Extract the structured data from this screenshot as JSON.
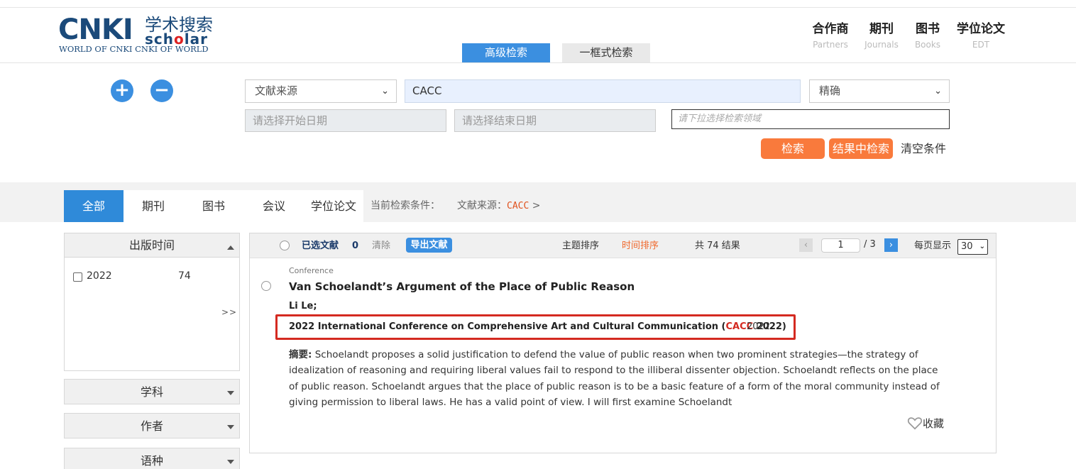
{
  "header": {
    "logo": {
      "main": "CNKI",
      "cn": "学术搜索",
      "scholar": "scholar",
      "slogan": "WORLD OF CNKI CNKI OF WORLD"
    },
    "nav": [
      {
        "zh": "合作商",
        "en": "Partners"
      },
      {
        "zh": "期刊",
        "en": "Journals"
      },
      {
        "zh": "图书",
        "en": "Books"
      },
      {
        "zh": "学位论文",
        "en": "EDT"
      }
    ],
    "search_tabs": {
      "advanced": "高级检索",
      "one_box": "一框式检索"
    }
  },
  "search_form": {
    "add_symbol": "+",
    "remove_symbol": "−",
    "field_select": "文献来源",
    "query_value": "CACC",
    "match_select": "精确",
    "start_date_placeholder": "请选择开始日期",
    "end_date_placeholder": "请选择结束日期",
    "domain_placeholder": "请下拉选择检索领域",
    "search_button": "检索",
    "search_within_button": "结果中检索",
    "clear_label": "清空条件"
  },
  "category_tabs": [
    "全部",
    "期刊",
    "图书",
    "会议",
    "学位论文"
  ],
  "current_condition": {
    "label": "当前检索条件：",
    "field": "文献来源：",
    "value": "CACC",
    "arrow": ">"
  },
  "filters": {
    "pub_time": {
      "title": "出版时间",
      "items": [
        {
          "label": "2022",
          "count": "74"
        }
      ],
      "more": ">>"
    },
    "subject": "学科",
    "author": "作者",
    "language": "语种"
  },
  "results_bar": {
    "selected_label": "已选文献",
    "selected_count": "0",
    "clear": "清除",
    "export": "导出文献",
    "sort_topic": "主题排序",
    "sort_time": "时间排序",
    "total": "共 74 结果",
    "prev": "‹",
    "page": "1",
    "page_total": "/ 3",
    "next": "›",
    "per_page_label": "每页显示",
    "per_page": "30"
  },
  "result": {
    "type": "Conference",
    "title": "Van Schoelandt’s Argument of the Place of Public Reason",
    "authors": "Li Le;",
    "source_prefix": "2022 International Conference on Comprehensive Art and Cultural Communication (",
    "source_highlight": "CACC",
    "source_suffix": " 2022)",
    "year": "2022",
    "abstract_label": "摘要:",
    "abstract": " Schoelandt proposes a solid justification to defend the value of public reason when two prominent strategies—the strategy of idealization of reasoning and requiring liberal values fail to respond to the illiberal dissenter objection. Schoelandt reflects on the place of public reason. Schoelandt argues that the place of public reason is to be a basic feature of a form of the moral community instead of giving permission to liberal laws. He has a valid point of view. I will first examine Schoelandt",
    "favorite": "收藏"
  },
  "colors": {
    "accent_blue": "#3b8fe0",
    "orange": "#f97a3c",
    "highlight_red": "#d42a21"
  }
}
